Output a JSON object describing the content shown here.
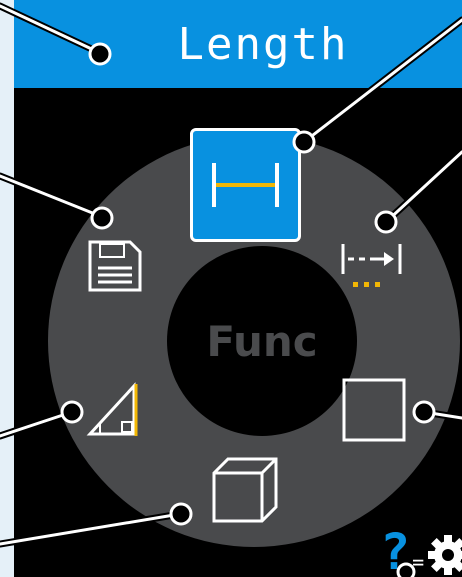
{
  "header": {
    "title": "Length"
  },
  "center": {
    "label": "Func"
  },
  "modes": [
    {
      "id": "length",
      "icon": "length-icon",
      "selected": true
    },
    {
      "id": "continuous",
      "icon": "continuous-measure-icon",
      "selected": false
    },
    {
      "id": "area",
      "icon": "area-icon",
      "selected": false
    },
    {
      "id": "volume",
      "icon": "volume-icon",
      "selected": false
    },
    {
      "id": "pythagoras",
      "icon": "pythagoras-icon",
      "selected": false
    },
    {
      "id": "memory",
      "icon": "memory-icon",
      "selected": false
    }
  ],
  "footer": {
    "help_symbol": "?",
    "equals_symbol": "=",
    "settings_icon": "gear-icon"
  },
  "colors": {
    "accent": "#0891e0",
    "ring": "#494a4c",
    "highlight": "#f2b705",
    "background": "#000000"
  }
}
